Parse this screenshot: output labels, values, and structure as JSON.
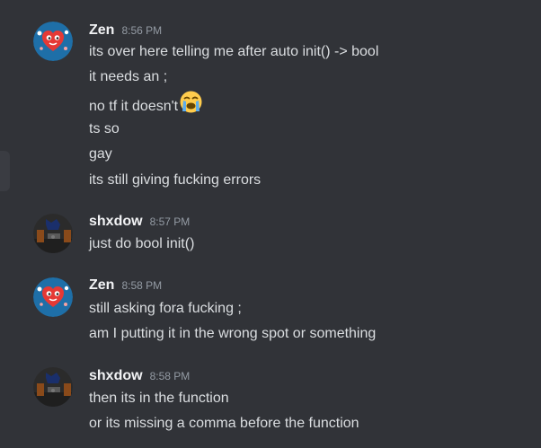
{
  "colors": {
    "background": "#313338",
    "author": "#f2f3f5",
    "text": "#dbdee1",
    "timestamp": "#949ba4"
  },
  "groups": [
    {
      "author": "Zen",
      "time": "8:56 PM",
      "avatar_icon": "heart-avatar-icon",
      "messages": [
        "its over here telling me after auto init() -> bool",
        "it needs an ;",
        "no tf it doesn't",
        "ts so",
        "gay",
        "its still giving fucking errors"
      ],
      "emoji_after_message_2": "loudly-crying-face-icon"
    },
    {
      "author": "shxdow",
      "time": "8:57 PM",
      "avatar_icon": "dark-scene-avatar-icon",
      "messages": [
        "just do bool init()"
      ]
    },
    {
      "author": "Zen",
      "time": "8:58 PM",
      "avatar_icon": "heart-avatar-icon",
      "messages": [
        "still asking fora fucking ;",
        "am I putting it in the wrong spot or something"
      ]
    },
    {
      "author": "shxdow",
      "time": "8:58 PM",
      "avatar_icon": "dark-scene-avatar-icon",
      "messages": [
        "then its in the function",
        "or its missing a comma before the function"
      ]
    }
  ]
}
